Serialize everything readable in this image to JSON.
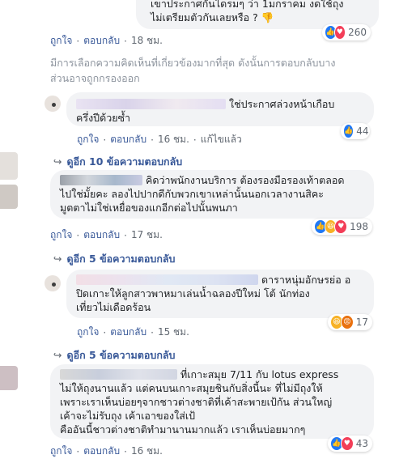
{
  "comments": [
    {
      "id": "c1",
      "lines": [
        "เขาประกาศกันไดรมๆ ว่า 1มกราคม งดใช้ถุง",
        "ไม่เตรียมตัวกันเลยหรือ ? 👎"
      ],
      "actions": {
        "like": "ถูกใจ",
        "reply": "ตอบกลับ",
        "time": "18 ชม."
      },
      "reactions": {
        "count": "260",
        "icons": [
          "like-icon",
          "love-icon"
        ]
      }
    },
    {
      "id": "c2",
      "lines": [
        "ใช่ประกาศล่วงหน้าเกือบ",
        "ครึ่งปีด้วยซ้ำ"
      ],
      "actions": {
        "like": "ถูกใจ",
        "reply": "ตอบกลับ",
        "time": "16 ชม.",
        "edited": "แก้ไขแล้ว"
      },
      "reactions": {
        "count": "44",
        "icons": [
          "like-icon"
        ]
      }
    },
    {
      "id": "c3",
      "lines": [
        "คิดว่าพนักงานบริการ ต้องรองมือรองเท้าตลอด",
        "ไปใช่มั้ยคะ ลองไปปากดีกับพวกเขาเหล่านั้นนอกเวลางานสิคะ",
        "มูตตาไม่ใช่เหยื่อของแกอีกต่อไปนั้นพนภา"
      ],
      "actions": {
        "like": "ถูกใจ",
        "reply": "ตอบกลับ",
        "time": "17 ชม."
      },
      "reactions": {
        "count": "198",
        "icons": [
          "like-icon",
          "haha-icon",
          "love-icon"
        ]
      }
    },
    {
      "id": "c4",
      "lines": [
        "ดาราหนุ่มอักษรย่อ อ",
        "ปิดเกาะให้ลูกสาวพาหมาเล่นน้ำฉลองปีใหม่ โต้ นักท่อง",
        "เที่ยวไม่เดือดร้อน"
      ],
      "actions": {
        "like": "ถูกใจ",
        "reply": "ตอบกลับ",
        "time": "15 ชม."
      },
      "reactions": {
        "count": "17",
        "icons": [
          "haha-icon",
          "angry-icon"
        ]
      }
    },
    {
      "id": "c5",
      "lines": [
        "ที่เกาะสมุย 7/11 กับ lotus express",
        "ไม่ให้ถุงนานแล้ว แต่คนบนเกาะสมุยชินกับสิ่งนี้นะ ที่ไม่มีถุงให้",
        "เพราะเราเห็นบ่อยๆจากชาวต่างชาติที่เค้าสะพายเป้กัน ส่วนใหญ่",
        "เค้าจะไม่รับถุง เค้าเอาของใส่เป้",
        "คืออันนี้ชาวต่างชาติทำมานานมากแล้ว เราเห็นบ่อยมากๆ"
      ],
      "actions": {
        "like": "ถูกใจ",
        "reply": "ตอบกลับ",
        "time": "16 ชม."
      },
      "reactions": {
        "count": "43",
        "icons": [
          "like-icon",
          "love-icon"
        ]
      }
    }
  ],
  "notice": [
    "มีการเลือกความคิดเห็นที่เกี่ยวข้องมากที่สุด ดังนั้นการตอบกลับบาง",
    "ส่วนอาจถูกกรองออก"
  ],
  "more_replies": [
    {
      "label": "ดูอีก 10 ข้อความตอบกลับ"
    },
    {
      "label": "ดูอีก 5 ข้อความตอบกลับ"
    },
    {
      "label": "ดูอีก 5 ข้อความตอบกลับ"
    }
  ],
  "colors": {
    "link": "#385898",
    "bubble": "#f2f3f5",
    "meta": "#606770"
  }
}
